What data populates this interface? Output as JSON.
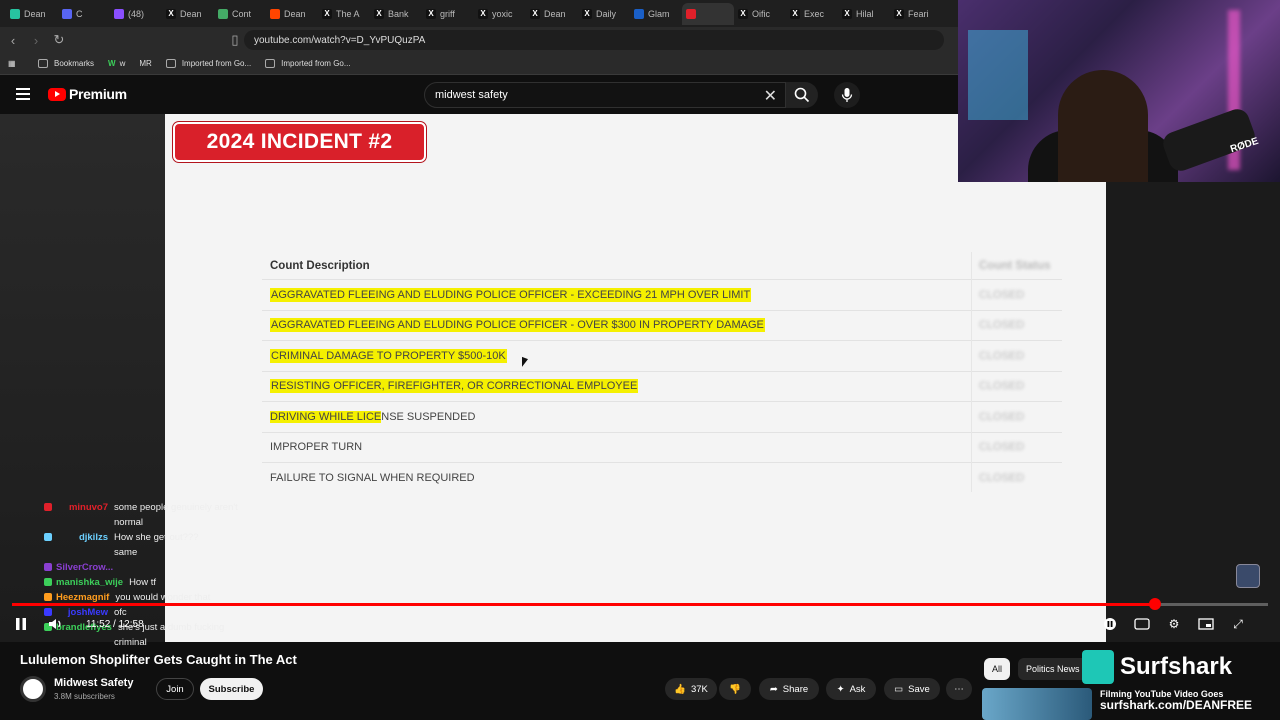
{
  "browser": {
    "tabs": [
      "Dean",
      "C",
      "(48)",
      "Dean",
      "Cont",
      "Dean",
      "The A",
      "Bank",
      "griff",
      "yoxic",
      "Dean",
      "Daily",
      "Glam",
      "",
      "Oific",
      "Exec",
      "Hilal",
      "Feari"
    ],
    "url": "youtube.com/watch?v=D_YvPUQuzPA",
    "bookmarks": [
      "Bookmarks",
      "w",
      "MR",
      "Imported from Go...",
      "Imported from Go..."
    ]
  },
  "youtube": {
    "logo_text": "Premium",
    "search_value": "midwest safety"
  },
  "video": {
    "badge": "2024 INCIDENT #2",
    "table_header": "Count Description",
    "table_header_col2": "Count Status",
    "rows": [
      {
        "desc": "AGGRAVATED FLEEING AND ELUDING POLICE OFFICER - EXCEEDING 21 MPH OVER LIMIT",
        "status": "CLOSED"
      },
      {
        "desc": "AGGRAVATED FLEEING AND ELUDING POLICE OFFICER - OVER $300 IN PROPERTY DAMAGE",
        "status": "CLOSED"
      },
      {
        "desc": "CRIMINAL DAMAGE TO PROPERTY $500-10K",
        "status": "CLOSED"
      },
      {
        "desc": "RESISTING OFFICER, FIREFIGHTER, OR CORRECTIONAL EMPLOYEE",
        "status": "CLOSED"
      },
      {
        "desc_hl": "DRIVING WHILE LICE",
        "desc_rest": "NSE SUSPENDED",
        "status": "CLOSED"
      },
      {
        "desc": "IMPROPER TURN",
        "status": "CLOSED"
      },
      {
        "desc": "FAILURE TO SIGNAL WHEN REQUIRED",
        "status": "CLOSED"
      }
    ],
    "time": "11:52 / 12:58",
    "progress": 0.91
  },
  "chat": [
    {
      "user": "minuvo7",
      "color": "#e0202a",
      "msg": "some people genuinely aren't"
    },
    {
      "user": "",
      "color": "#e0202a",
      "msg": "normal"
    },
    {
      "user": "djkilzs",
      "color": "#6cd0ff",
      "msg": "How she get out???"
    },
    {
      "user": "",
      "color": "#7a7aff",
      "msg": "same"
    },
    {
      "user": "SilverCrow...",
      "color": "#8a3fd1",
      "msg": ""
    },
    {
      "user": "manishka_wije",
      "color": "#3ccf5a",
      "msg": "How tf"
    },
    {
      "user": "Heezmagnif",
      "color": "#ff9d1e",
      "msg": "you would wonder that"
    },
    {
      "user": "joshMew",
      "color": "#3a3aff",
      "msg": "ofc"
    },
    {
      "user": "brandleflyes",
      "color": "#3ccf5a",
      "msg": "she's just a dumb fucking"
    },
    {
      "user": "",
      "color": "#3ccf5a",
      "msg": "criminal"
    }
  ],
  "below": {
    "title": "Lululemon Shoplifter Gets Caught in The Act",
    "channel": "Midwest Safety",
    "subs": "3.8M subscribers",
    "join": "Join",
    "subscribe": "Subscribe",
    "likes": "37K",
    "share": "Share",
    "ask": "Ask",
    "save": "Save",
    "chips": [
      "All",
      "Politics News"
    ],
    "sponsor": "Surfshark",
    "rec_title": "Filming YouTube Video Goes",
    "rec_url": "surfshark.com/DEANFREE"
  },
  "webcam": {
    "mic_brand": "RØDE"
  }
}
